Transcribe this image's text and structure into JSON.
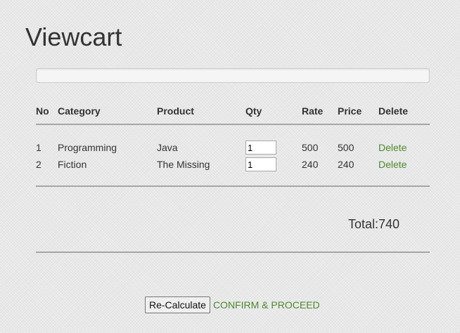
{
  "page": {
    "title": "Viewcart"
  },
  "progress": {
    "fraction": 0
  },
  "table": {
    "headers": [
      "No",
      "Category",
      "Product",
      "Qty",
      "Rate",
      "Price",
      "Delete"
    ],
    "rows": [
      {
        "no": "1",
        "category": "Programming",
        "product": "Java",
        "qty": "1",
        "rate": "500",
        "price": "500",
        "delete": "Delete"
      },
      {
        "no": "2",
        "category": "Fiction",
        "product": "The Missing",
        "qty": "1",
        "rate": "240",
        "price": "240",
        "delete": "Delete"
      }
    ]
  },
  "total": {
    "text": "Total:740"
  },
  "actions": {
    "recalculate": "Re-Calculate",
    "confirm": "CONFIRM & PROCEED"
  },
  "colors": {
    "link": "#4e8a2e",
    "rule": "#a6a6a6",
    "text": "#333333"
  }
}
